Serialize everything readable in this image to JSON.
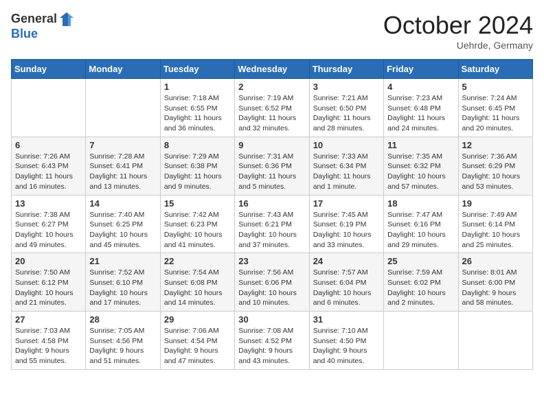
{
  "logo": {
    "general": "General",
    "blue": "Blue"
  },
  "title": "October 2024",
  "location": "Uehrde, Germany",
  "days_of_week": [
    "Sunday",
    "Monday",
    "Tuesday",
    "Wednesday",
    "Thursday",
    "Friday",
    "Saturday"
  ],
  "weeks": [
    [
      {
        "day": "",
        "sunrise": "",
        "sunset": "",
        "daylight": ""
      },
      {
        "day": "",
        "sunrise": "",
        "sunset": "",
        "daylight": ""
      },
      {
        "day": "1",
        "sunrise": "Sunrise: 7:18 AM",
        "sunset": "Sunset: 6:55 PM",
        "daylight": "Daylight: 11 hours and 36 minutes."
      },
      {
        "day": "2",
        "sunrise": "Sunrise: 7:19 AM",
        "sunset": "Sunset: 6:52 PM",
        "daylight": "Daylight: 11 hours and 32 minutes."
      },
      {
        "day": "3",
        "sunrise": "Sunrise: 7:21 AM",
        "sunset": "Sunset: 6:50 PM",
        "daylight": "Daylight: 11 hours and 28 minutes."
      },
      {
        "day": "4",
        "sunrise": "Sunrise: 7:23 AM",
        "sunset": "Sunset: 6:48 PM",
        "daylight": "Daylight: 11 hours and 24 minutes."
      },
      {
        "day": "5",
        "sunrise": "Sunrise: 7:24 AM",
        "sunset": "Sunset: 6:45 PM",
        "daylight": "Daylight: 11 hours and 20 minutes."
      }
    ],
    [
      {
        "day": "6",
        "sunrise": "Sunrise: 7:26 AM",
        "sunset": "Sunset: 6:43 PM",
        "daylight": "Daylight: 11 hours and 16 minutes."
      },
      {
        "day": "7",
        "sunrise": "Sunrise: 7:28 AM",
        "sunset": "Sunset: 6:41 PM",
        "daylight": "Daylight: 11 hours and 13 minutes."
      },
      {
        "day": "8",
        "sunrise": "Sunrise: 7:29 AM",
        "sunset": "Sunset: 6:38 PM",
        "daylight": "Daylight: 11 hours and 9 minutes."
      },
      {
        "day": "9",
        "sunrise": "Sunrise: 7:31 AM",
        "sunset": "Sunset: 6:36 PM",
        "daylight": "Daylight: 11 hours and 5 minutes."
      },
      {
        "day": "10",
        "sunrise": "Sunrise: 7:33 AM",
        "sunset": "Sunset: 6:34 PM",
        "daylight": "Daylight: 11 hours and 1 minute."
      },
      {
        "day": "11",
        "sunrise": "Sunrise: 7:35 AM",
        "sunset": "Sunset: 6:32 PM",
        "daylight": "Daylight: 10 hours and 57 minutes."
      },
      {
        "day": "12",
        "sunrise": "Sunrise: 7:36 AM",
        "sunset": "Sunset: 6:29 PM",
        "daylight": "Daylight: 10 hours and 53 minutes."
      }
    ],
    [
      {
        "day": "13",
        "sunrise": "Sunrise: 7:38 AM",
        "sunset": "Sunset: 6:27 PM",
        "daylight": "Daylight: 10 hours and 49 minutes."
      },
      {
        "day": "14",
        "sunrise": "Sunrise: 7:40 AM",
        "sunset": "Sunset: 6:25 PM",
        "daylight": "Daylight: 10 hours and 45 minutes."
      },
      {
        "day": "15",
        "sunrise": "Sunrise: 7:42 AM",
        "sunset": "Sunset: 6:23 PM",
        "daylight": "Daylight: 10 hours and 41 minutes."
      },
      {
        "day": "16",
        "sunrise": "Sunrise: 7:43 AM",
        "sunset": "Sunset: 6:21 PM",
        "daylight": "Daylight: 10 hours and 37 minutes."
      },
      {
        "day": "17",
        "sunrise": "Sunrise: 7:45 AM",
        "sunset": "Sunset: 6:19 PM",
        "daylight": "Daylight: 10 hours and 33 minutes."
      },
      {
        "day": "18",
        "sunrise": "Sunrise: 7:47 AM",
        "sunset": "Sunset: 6:16 PM",
        "daylight": "Daylight: 10 hours and 29 minutes."
      },
      {
        "day": "19",
        "sunrise": "Sunrise: 7:49 AM",
        "sunset": "Sunset: 6:14 PM",
        "daylight": "Daylight: 10 hours and 25 minutes."
      }
    ],
    [
      {
        "day": "20",
        "sunrise": "Sunrise: 7:50 AM",
        "sunset": "Sunset: 6:12 PM",
        "daylight": "Daylight: 10 hours and 21 minutes."
      },
      {
        "day": "21",
        "sunrise": "Sunrise: 7:52 AM",
        "sunset": "Sunset: 6:10 PM",
        "daylight": "Daylight: 10 hours and 17 minutes."
      },
      {
        "day": "22",
        "sunrise": "Sunrise: 7:54 AM",
        "sunset": "Sunset: 6:08 PM",
        "daylight": "Daylight: 10 hours and 14 minutes."
      },
      {
        "day": "23",
        "sunrise": "Sunrise: 7:56 AM",
        "sunset": "Sunset: 6:06 PM",
        "daylight": "Daylight: 10 hours and 10 minutes."
      },
      {
        "day": "24",
        "sunrise": "Sunrise: 7:57 AM",
        "sunset": "Sunset: 6:04 PM",
        "daylight": "Daylight: 10 hours and 6 minutes."
      },
      {
        "day": "25",
        "sunrise": "Sunrise: 7:59 AM",
        "sunset": "Sunset: 6:02 PM",
        "daylight": "Daylight: 10 hours and 2 minutes."
      },
      {
        "day": "26",
        "sunrise": "Sunrise: 8:01 AM",
        "sunset": "Sunset: 6:00 PM",
        "daylight": "Daylight: 9 hours and 58 minutes."
      }
    ],
    [
      {
        "day": "27",
        "sunrise": "Sunrise: 7:03 AM",
        "sunset": "Sunset: 4:58 PM",
        "daylight": "Daylight: 9 hours and 55 minutes."
      },
      {
        "day": "28",
        "sunrise": "Sunrise: 7:05 AM",
        "sunset": "Sunset: 4:56 PM",
        "daylight": "Daylight: 9 hours and 51 minutes."
      },
      {
        "day": "29",
        "sunrise": "Sunrise: 7:06 AM",
        "sunset": "Sunset: 4:54 PM",
        "daylight": "Daylight: 9 hours and 47 minutes."
      },
      {
        "day": "30",
        "sunrise": "Sunrise: 7:08 AM",
        "sunset": "Sunset: 4:52 PM",
        "daylight": "Daylight: 9 hours and 43 minutes."
      },
      {
        "day": "31",
        "sunrise": "Sunrise: 7:10 AM",
        "sunset": "Sunset: 4:50 PM",
        "daylight": "Daylight: 9 hours and 40 minutes."
      },
      {
        "day": "",
        "sunrise": "",
        "sunset": "",
        "daylight": ""
      },
      {
        "day": "",
        "sunrise": "",
        "sunset": "",
        "daylight": ""
      }
    ]
  ]
}
